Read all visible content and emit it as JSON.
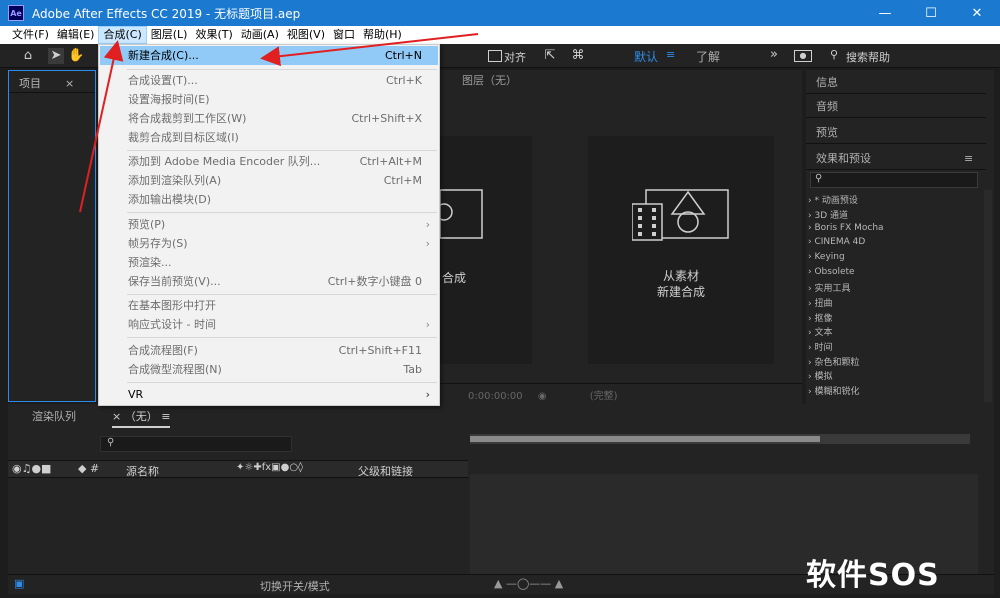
{
  "window": {
    "title": "Adobe After Effects CC 2019 - 无标题项目.aep",
    "app_icon": "Ae"
  },
  "menubar": [
    "文件(F)",
    "编辑(E)",
    "合成(C)",
    "图层(L)",
    "效果(T)",
    "动画(A)",
    "视图(V)",
    "窗口",
    "帮助(H)"
  ],
  "toolbar": {
    "align_label": "对齐",
    "workspace_default": "默认",
    "workspace_learn": "了解",
    "search_placeholder": "搜索帮助"
  },
  "project_panel": {
    "tab": "项目"
  },
  "viewer": {
    "tab": "图层（无）",
    "new_comp_label": "合成",
    "from_footage_line1": "从素材",
    "from_footage_line2": "新建合成",
    "timecode": "0:00:00:00",
    "resolution": "(完整)"
  },
  "right_panel": {
    "tabs": [
      "信息",
      "音频",
      "预览",
      "效果和预设"
    ],
    "effects": [
      "* 动画预设",
      "3D 通道",
      "Boris FX Mocha",
      "CINEMA 4D",
      "Keying",
      "Obsolete",
      "实用工具",
      "扭曲",
      "抠像",
      "文本",
      "时间",
      "杂色和颗粒",
      "模拟",
      "模糊和锐化"
    ]
  },
  "timeline": {
    "tab_render": "渲染队列",
    "tab_comp": "（无）",
    "col_source": "源名称",
    "col_parent": "父级和链接",
    "footer_toggle": "切换开关/模式"
  },
  "composition_menu": [
    {
      "label": "新建合成(C)...",
      "shortcut": "Ctrl+N",
      "enabled": true,
      "highlight": true
    },
    {
      "label": "合成设置(T)...",
      "shortcut": "Ctrl+K",
      "enabled": false
    },
    {
      "label": "设置海报时间(E)",
      "shortcut": "",
      "enabled": false
    },
    {
      "label": "将合成裁剪到工作区(W)",
      "shortcut": "Ctrl+Shift+X",
      "enabled": false
    },
    {
      "label": "裁剪合成到目标区域(I)",
      "shortcut": "",
      "enabled": false
    },
    {
      "label": "添加到 Adobe Media Encoder 队列...",
      "shortcut": "Ctrl+Alt+M",
      "enabled": false
    },
    {
      "label": "添加到渲染队列(A)",
      "shortcut": "Ctrl+M",
      "enabled": false
    },
    {
      "label": "添加输出模块(D)",
      "shortcut": "",
      "enabled": false
    },
    {
      "label": "预览(P)",
      "shortcut": "",
      "enabled": false,
      "submenu": true
    },
    {
      "label": "帧另存为(S)",
      "shortcut": "",
      "enabled": false,
      "submenu": true
    },
    {
      "label": "预渲染...",
      "shortcut": "",
      "enabled": false
    },
    {
      "label": "保存当前预览(V)...",
      "shortcut": "Ctrl+数字小键盘 0",
      "enabled": false
    },
    {
      "label": "在基本图形中打开",
      "shortcut": "",
      "enabled": false
    },
    {
      "label": "响应式设计 - 时间",
      "shortcut": "",
      "enabled": false,
      "submenu": true
    },
    {
      "label": "合成流程图(F)",
      "shortcut": "Ctrl+Shift+F11",
      "enabled": false
    },
    {
      "label": "合成微型流程图(N)",
      "shortcut": "Tab",
      "enabled": false
    },
    {
      "label": "VR",
      "shortcut": "",
      "enabled": true,
      "submenu": true
    }
  ],
  "watermark": "软件SOS"
}
